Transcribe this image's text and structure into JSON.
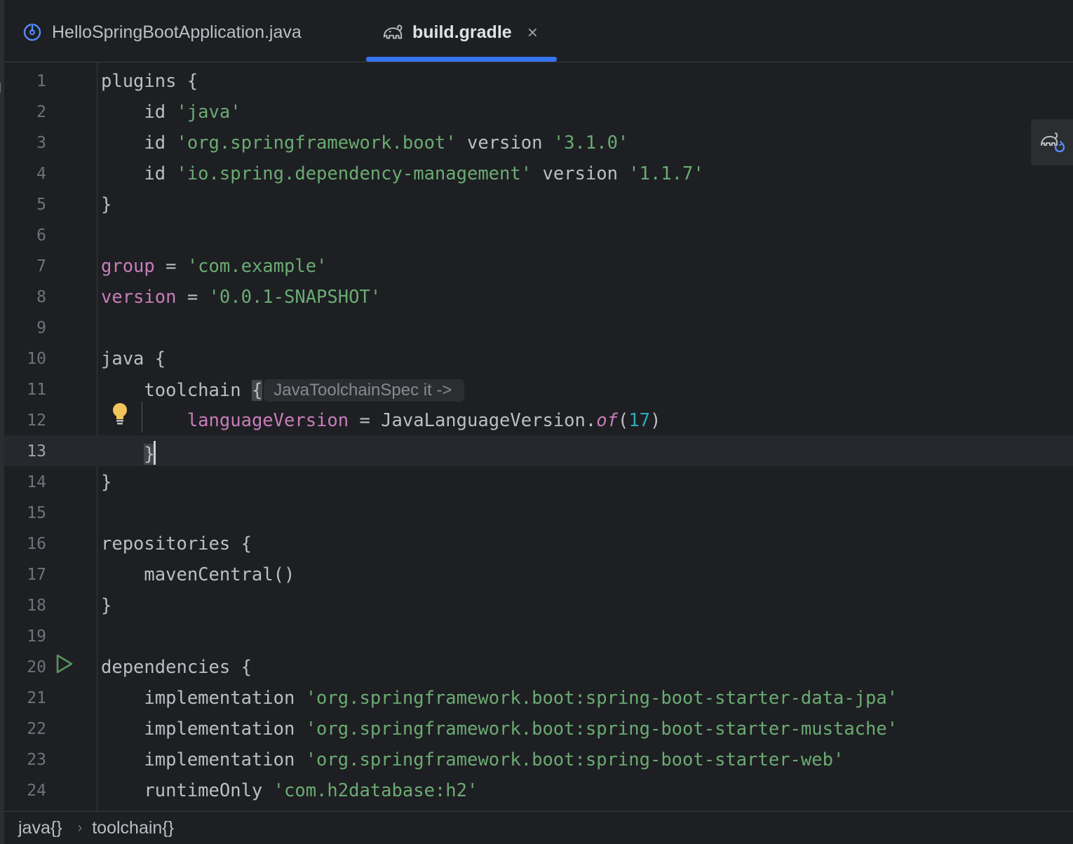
{
  "tabs": [
    {
      "label": "HelloSpringBootApplication.java",
      "icon": "spring-boot-icon",
      "active": false
    },
    {
      "label": "build.gradle",
      "icon": "gradle-elephant-icon",
      "active": true,
      "close_glyph": "×"
    }
  ],
  "editor": {
    "current_line": 13,
    "inlay_hint": "JavaToolchainSpec it ->",
    "lines": [
      {
        "no": "1"
      },
      {
        "no": "2"
      },
      {
        "no": "3"
      },
      {
        "no": "4"
      },
      {
        "no": "5"
      },
      {
        "no": "6"
      },
      {
        "no": "7"
      },
      {
        "no": "8"
      },
      {
        "no": "9"
      },
      {
        "no": "10"
      },
      {
        "no": "11"
      },
      {
        "no": "12"
      },
      {
        "no": "13"
      },
      {
        "no": "14"
      },
      {
        "no": "15"
      },
      {
        "no": "16"
      },
      {
        "no": "17"
      },
      {
        "no": "18"
      },
      {
        "no": "19"
      },
      {
        "no": "20"
      },
      {
        "no": "21"
      },
      {
        "no": "22"
      },
      {
        "no": "23"
      },
      {
        "no": "24"
      }
    ],
    "code": {
      "l1_a": "plugins {",
      "l2_a": "    id ",
      "l2_s": "'java'",
      "l3_a": "    id ",
      "l3_s1": "'org.springframework.boot'",
      "l3_b": " version ",
      "l3_s2": "'3.1.0'",
      "l4_a": "    id ",
      "l4_s1": "'io.spring.dependency-management'",
      "l4_b": " version ",
      "l4_s2": "'1.1.7'",
      "l5_a": "}",
      "l7_p": "group",
      "l7_b": " = ",
      "l7_s": "'com.example'",
      "l8_p": "version",
      "l8_b": " = ",
      "l8_s": "'0.0.1-SNAPSHOT'",
      "l10_a": "java {",
      "l11_a": "    toolchain ",
      "l11_brace": "{",
      "l12_pad": "        ",
      "l12_p": "languageVersion",
      "l12_b": " = JavaLanguageVersion.",
      "l12_i": "of",
      "l12_c": "(",
      "l12_n": "17",
      "l12_d": ")",
      "l13_pad": "    ",
      "l13_brace": "}",
      "l14_a": "}",
      "l16_a": "repositories {",
      "l17_a": "    mavenCentral()",
      "l18_a": "}",
      "l20_a": "dependencies {",
      "l21_a": "    implementation ",
      "l21_s": "'org.springframework.boot:spring-boot-starter-data-jpa'",
      "l22_a": "    implementation ",
      "l22_s": "'org.springframework.boot:spring-boot-starter-mustache'",
      "l23_a": "    implementation ",
      "l23_s": "'org.springframework.boot:spring-boot-starter-web'",
      "l24_a": "    runtimeOnly ",
      "l24_s": "'com.h2database:h2'"
    }
  },
  "breadcrumb": {
    "items": [
      "java{}",
      "toolchain{}"
    ],
    "separator": "›"
  },
  "colors": {
    "background": "#1e1f22",
    "accent": "#3574f0",
    "string": "#6aab73",
    "property": "#c77dbb",
    "number": "#2aacb8",
    "text": "#bcbec4"
  }
}
